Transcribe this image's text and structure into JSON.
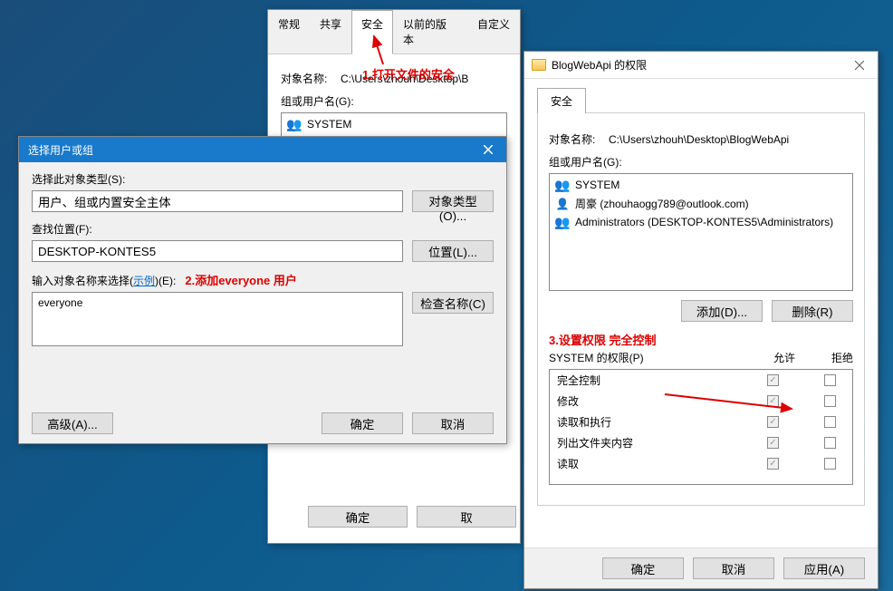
{
  "props_window": {
    "tabs": [
      "常规",
      "共享",
      "安全",
      "以前的版本",
      "自定义"
    ],
    "active_tab_index": 2,
    "object_name_label": "对象名称:",
    "object_path": "C:\\Users\\zhouh\\Desktop\\B",
    "groups_label": "组或用户名(G):",
    "system_user": "SYSTEM",
    "ok": "确定",
    "cancel": "取"
  },
  "annotations": {
    "a1": "1.打开文件的安全",
    "a2": "2.添加everyone 用户",
    "a3": "3.设置权限 完全控制"
  },
  "select_dialog": {
    "title": "选择用户或组",
    "object_type_label": "选择此对象类型(S):",
    "object_type_value": "用户、组或内置安全主体",
    "object_type_btn": "对象类型(O)...",
    "location_label": "查找位置(F):",
    "location_value": "DESKTOP-KONTES5",
    "location_btn": "位置(L)...",
    "names_label": "输入对象名称来选择(",
    "example_link": "示例",
    "names_label_after": ")(E):",
    "names_value": "everyone",
    "check_btn": "检查名称(C)",
    "advanced_btn": "高级(A)...",
    "ok": "确定",
    "cancel": "取消"
  },
  "perm_window": {
    "title": "BlogWebApi 的权限",
    "tab": "安全",
    "object_name_label": "对象名称:",
    "object_path": "C:\\Users\\zhouh\\Desktop\\BlogWebApi",
    "groups_label": "组或用户名(G):",
    "users": [
      {
        "icon": "people",
        "name": "SYSTEM"
      },
      {
        "icon": "person",
        "name": "周豪 (zhouhaogg789@outlook.com)"
      },
      {
        "icon": "people",
        "name": "Administrators (DESKTOP-KONTES5\\Administrators)"
      }
    ],
    "add_btn": "添加(D)...",
    "remove_btn": "删除(R)",
    "perm_for": "SYSTEM 的权限(P)",
    "allow": "允许",
    "deny": "拒绝",
    "permissions": [
      {
        "name": "完全控制",
        "allow": true,
        "deny": false
      },
      {
        "name": "修改",
        "allow": true,
        "deny": false
      },
      {
        "name": "读取和执行",
        "allow": true,
        "deny": false
      },
      {
        "name": "列出文件夹内容",
        "allow": true,
        "deny": false
      },
      {
        "name": "读取",
        "allow": true,
        "deny": false
      }
    ],
    "ok": "确定",
    "cancel": "取消",
    "apply": "应用(A)"
  }
}
